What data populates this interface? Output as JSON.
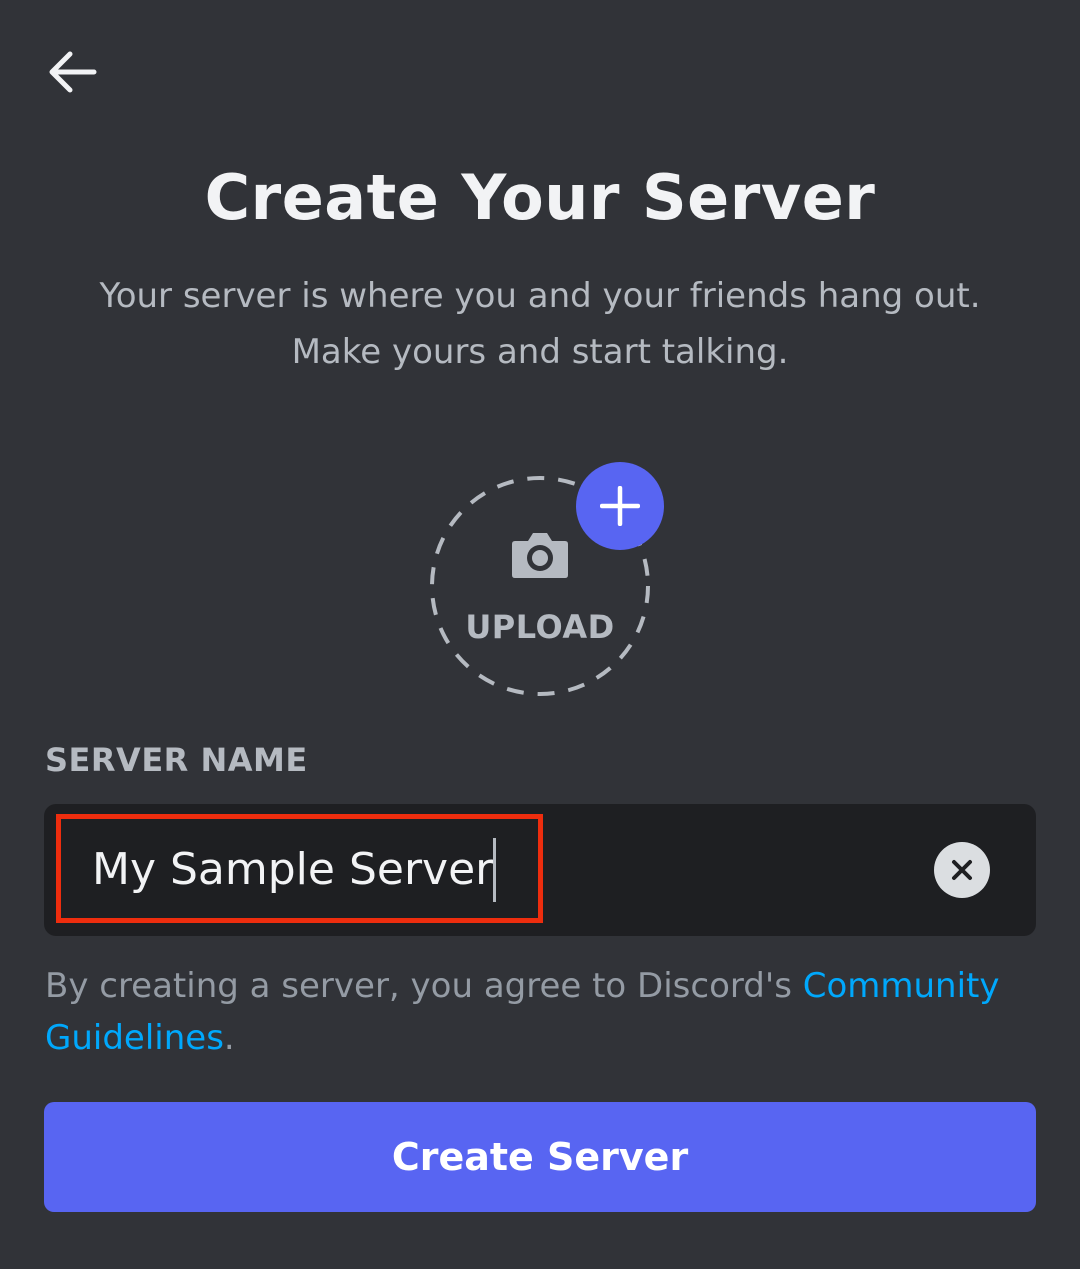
{
  "header": {
    "back_icon": "arrow-left-icon",
    "title": "Create Your Server",
    "subtitle_line1": "Your server is where you and your friends hang out.",
    "subtitle_line2": "Make yours and start talking."
  },
  "upload": {
    "label": "UPLOAD",
    "camera_icon": "camera-icon",
    "add_icon": "plus-icon"
  },
  "server_name": {
    "label": "SERVER NAME",
    "value": "My Sample Server",
    "clear_icon": "close-icon"
  },
  "terms": {
    "text": "By creating a server, you agree to Discord's ",
    "link": "Community Guidelines",
    "end": "."
  },
  "actions": {
    "create_label": "Create Server"
  },
  "colors": {
    "background": "#313338",
    "input_background": "#1e1f22",
    "accent": "#5865f2",
    "link": "#00a8fc",
    "highlight": "#ee2d0e"
  }
}
